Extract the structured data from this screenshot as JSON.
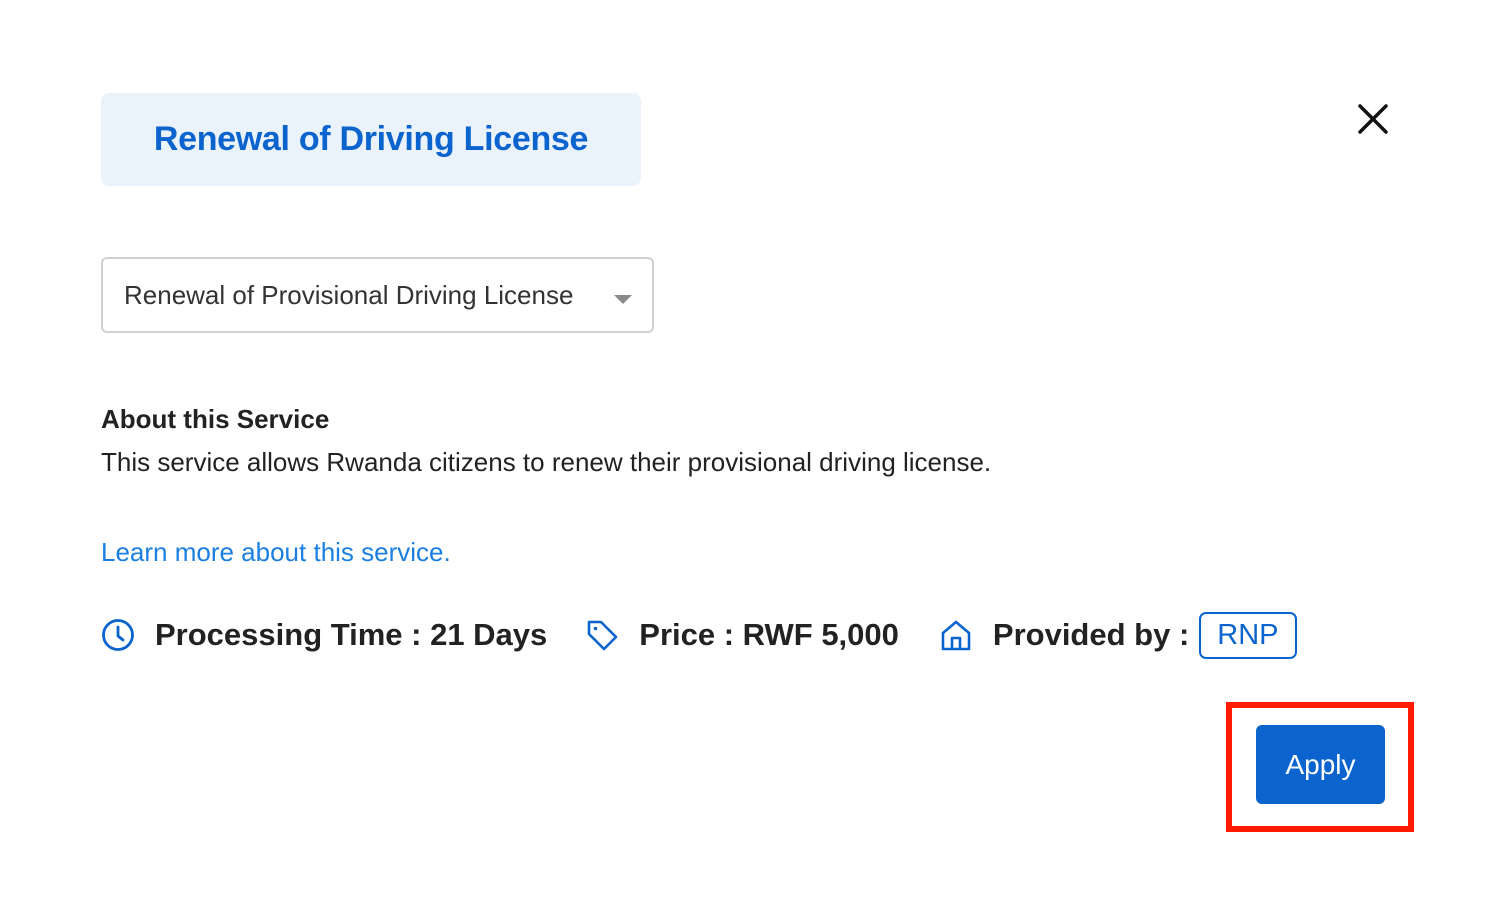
{
  "modal": {
    "title": "Renewal of Driving License",
    "close_icon": "close-icon"
  },
  "service_select": {
    "selected_value": "Renewal of Provisional Driving License"
  },
  "about": {
    "heading": "About this Service",
    "description": "This service allows Rwanda citizens to renew their provisional driving license.",
    "learn_more_label": "Learn more about this service."
  },
  "meta": {
    "processing_time": {
      "icon": "clock-icon",
      "label": "Processing Time : 21 Days"
    },
    "price": {
      "icon": "price-tag-icon",
      "label": "Price : RWF 5,000"
    },
    "provider": {
      "icon": "home-icon",
      "label": "Provided by :",
      "badge": "RNP"
    }
  },
  "actions": {
    "apply_label": "Apply"
  },
  "colors": {
    "brand_blue": "#0b63ce",
    "link_blue": "#1a7fe0",
    "title_chip_bg": "#eaf2fc",
    "highlight_red": "#ff1a00"
  }
}
